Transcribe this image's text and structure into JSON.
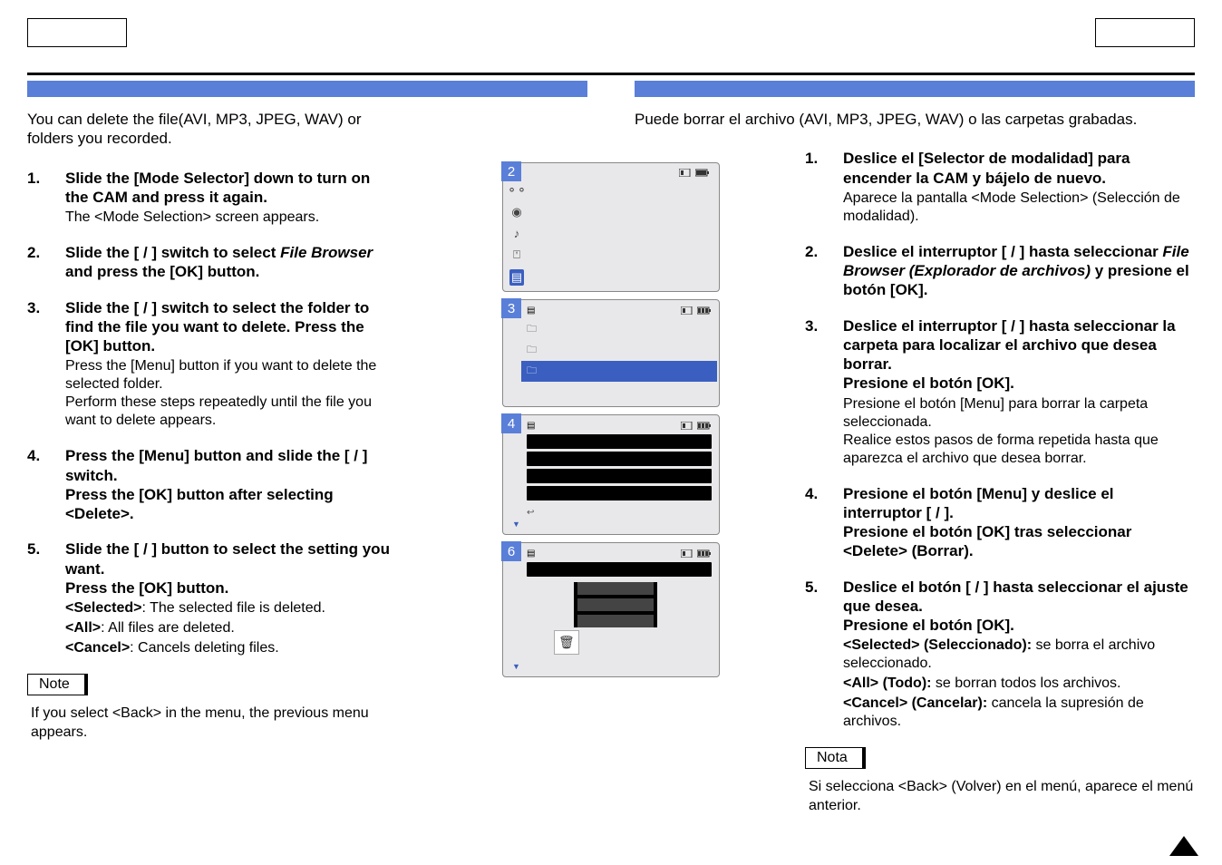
{
  "left": {
    "intro": "You can delete the file(AVI, MP3, JPEG, WAV) or folders you recorded.",
    "steps": [
      {
        "num": "1.",
        "main_before": "Slide the [Mode Selector] down to turn on the CAM and press it again.",
        "sub": "The <Mode Selection> screen appears."
      },
      {
        "num": "2.",
        "main_parts": [
          "Slide the [   /   ] switch to select ",
          "File Browser",
          " and press the [OK] button."
        ]
      },
      {
        "num": "3.",
        "main_before": "Slide the [   /   ] switch to select the folder to find the file you want to delete. Press the [OK] button.",
        "sub": "Press the [Menu] button if you want to delete the selected folder.\nPerform these steps repeatedly until the file you want to delete appears."
      },
      {
        "num": "4.",
        "main_before": "Press the [Menu] button and slide the [   /   ] switch.\nPress the [OK] button after selecting <Delete>."
      },
      {
        "num": "5.",
        "main_before": "Slide the [   /   ] button to select the setting you want.\nPress the [OK] button.",
        "subs": [
          {
            "label": "<Selected>",
            "text": ": The selected file is deleted."
          },
          {
            "label": "<All>",
            "text": ": All files are deleted."
          },
          {
            "label": "<Cancel>",
            "text": ": Cancels deleting files."
          }
        ]
      }
    ],
    "note_label": "Note",
    "note_text": "If you select <Back> in the menu, the previous menu appears."
  },
  "right": {
    "intro": "Puede borrar el archivo (AVI, MP3, JPEG, WAV) o las carpetas grabadas.",
    "steps": [
      {
        "num": "1.",
        "main_before": "Deslice el [Selector de modalidad] para encender la CAM y bájelo de nuevo.",
        "sub": "Aparece la pantalla <Mode Selection> (Selección de modalidad)."
      },
      {
        "num": "2.",
        "main_parts": [
          "Deslice el interruptor [   /   ] hasta seleccionar ",
          "File Browser (Explorador de archivos)",
          " y presione el botón [OK]."
        ]
      },
      {
        "num": "3.",
        "main_before": "Deslice el interruptor [   /   ] hasta seleccionar la carpeta para localizar el archivo que desea borrar.\nPresione el botón [OK].",
        "sub": "Presione el botón [Menu] para borrar la carpeta seleccionada.\nRealice estos pasos de forma repetida hasta que aparezca el archivo que desea borrar."
      },
      {
        "num": "4.",
        "main_before": "Presione el botón [Menu] y deslice el interruptor [   /   ].\nPresione el botón [OK] tras seleccionar <Delete> (Borrar)."
      },
      {
        "num": "5.",
        "main_before": "Deslice el botón [   /   ] hasta seleccionar el ajuste que desea.\nPresione el botón [OK].",
        "subs": [
          {
            "label": "<Selected> (Seleccionado):",
            "text": " se borra el archivo seleccionado."
          },
          {
            "label": "<All> (Todo):",
            "text": " se borran todos los archivos."
          },
          {
            "label": "<Cancel> (Cancelar):",
            "text": " cancela la supresión de archivos."
          }
        ]
      }
    ],
    "note_label": "Nota",
    "note_text": "Si selecciona <Back> (Volver) en el menú, aparece el menú anterior."
  },
  "device": {
    "panel2_tag": "2",
    "panel3_tag": "3",
    "panel4_tag": "4",
    "panel6_tag": "6",
    "folders": [
      "",
      "",
      ""
    ]
  }
}
